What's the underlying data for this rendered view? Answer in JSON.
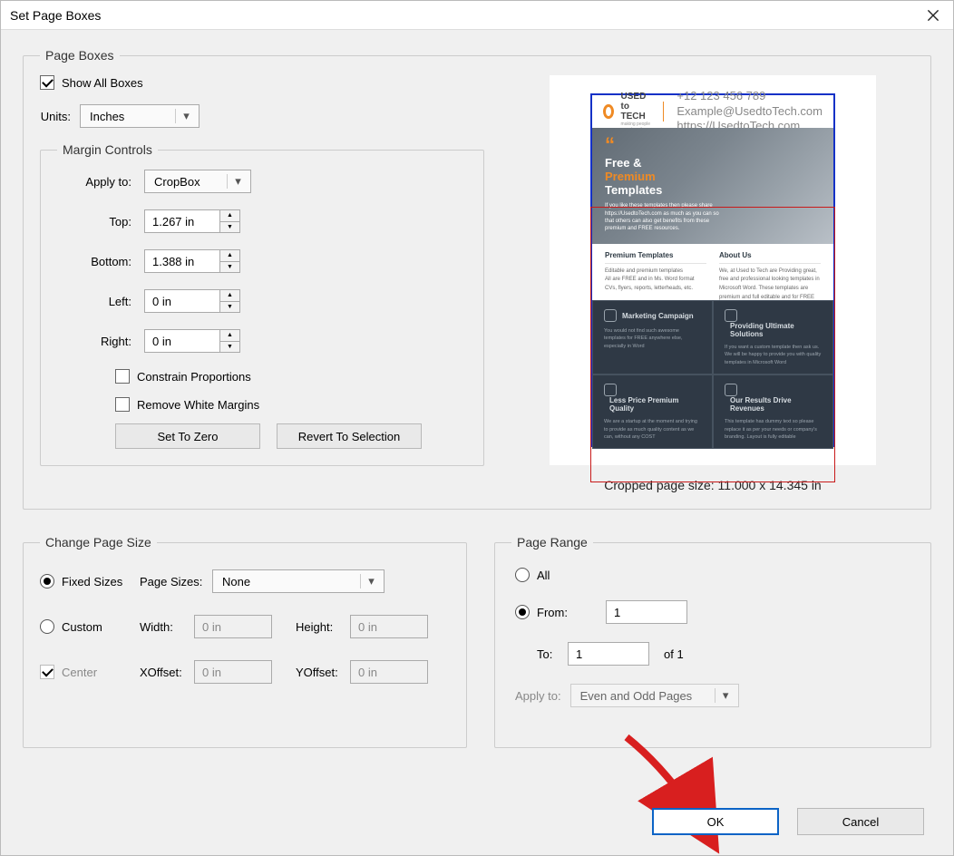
{
  "window": {
    "title": "Set Page Boxes"
  },
  "page_boxes": {
    "legend": "Page Boxes",
    "show_all_boxes": "Show All Boxes",
    "units_label": "Units:",
    "units_value": "Inches",
    "margin_controls": {
      "legend": "Margin Controls",
      "apply_to_label": "Apply to:",
      "apply_to_value": "CropBox",
      "top_label": "Top:",
      "top_value": "1.267 in",
      "bottom_label": "Bottom:",
      "bottom_value": "1.388 in",
      "left_label": "Left:",
      "left_value": "0 in",
      "right_label": "Right:",
      "right_value": "0 in",
      "constrain": "Constrain Proportions",
      "remove_white": "Remove White Margins",
      "set_zero": "Set To Zero",
      "revert": "Revert To Selection"
    },
    "preview": {
      "brand": "USED to TECH",
      "brand_sub": "making people smart work",
      "contact1": "+12 123 456 789",
      "contact2": "Example@UsedtoTech.com",
      "contact3": "https://UsedtoTech.com",
      "hero_line1": "Free &",
      "hero_line2": "Premium",
      "hero_line3": "Templates",
      "hero_p": "If you like these templates then please share https://UsedtoTech.com as much as you can so that others can also get benefits from these premium and FREE resources.",
      "mid_left_h": "Premium Templates",
      "mid_left_1": "Editable and premium templates",
      "mid_left_2": "All are FREE and in Ms. Word format",
      "mid_left_3": "CVs, flyers, reports, letterheads, etc.",
      "mid_right_h": "About Us",
      "mid_right_p": "We, at Used to Tech are Providing great, free and professional looking templates in Microsoft Word. These templates are premium and full editable and for FREE",
      "c1_t": "Marketing Campaign",
      "c1_p": "You would not find such awesome templates for FREE anywhere else, especially in Word",
      "c2_t": "Providing Ultimate Solutions",
      "c2_p": "If you want a custom template then ask us. We will be happy to provide you with quality templates in Microsoft Word",
      "c3_t": "Less Price Premium Quality",
      "c3_p": "We are a startup at the moment and trying to provide as much quality content as we can, without any COST",
      "c4_t": "Our Results Drive Revenues",
      "c4_p": "This template has dummy text so please replace it as per your needs or company's branding. Layout is fully editable"
    },
    "cropped_label": "Cropped page size: 11.000 x 14.345 in"
  },
  "change_size": {
    "legend": "Change Page Size",
    "fixed": "Fixed Sizes",
    "page_sizes_label": "Page Sizes:",
    "page_sizes_value": "None",
    "custom": "Custom",
    "width_label": "Width:",
    "width_value": "0 in",
    "height_label": "Height:",
    "height_value": "0 in",
    "center": "Center",
    "xoff_label": "XOffset:",
    "xoff_value": "0 in",
    "yoff_label": "YOffset:",
    "yoff_value": "0 in"
  },
  "page_range": {
    "legend": "Page Range",
    "all": "All",
    "from": "From:",
    "from_value": "1",
    "to": "To:",
    "to_value": "1",
    "of": "of 1",
    "apply_to_label": "Apply to:",
    "apply_to_value": "Even and Odd Pages"
  },
  "buttons": {
    "ok": "OK",
    "cancel": "Cancel"
  }
}
